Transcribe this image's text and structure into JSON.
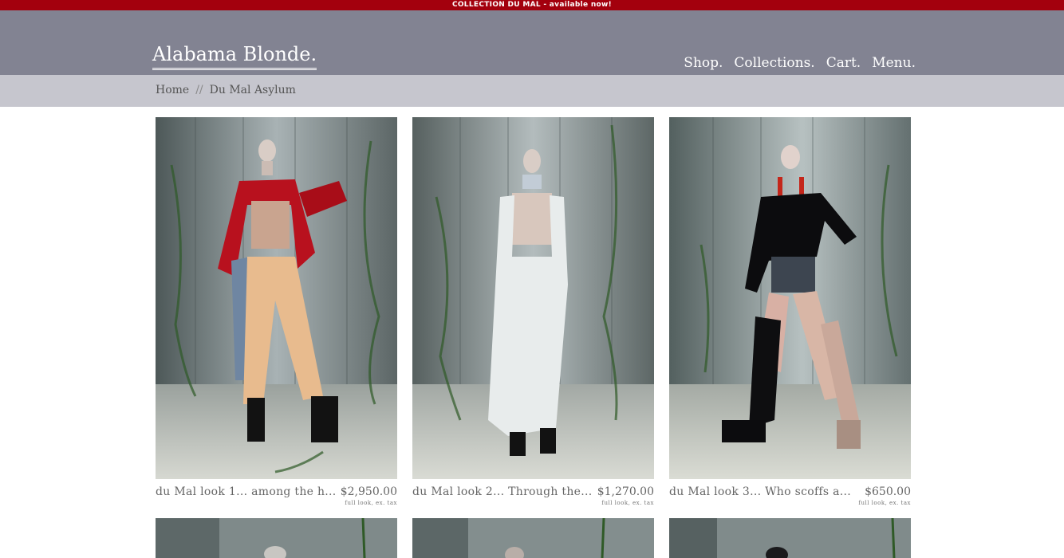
{
  "announcement": "COLLECTION DU MAL - available now!",
  "brand": "Alabama Blonde.",
  "nav": [
    "Shop.",
    "Collections.",
    "Cart.",
    "Menu."
  ],
  "breadcrumb": {
    "home": "Home",
    "separator": "//",
    "current": "Du Mal Asylum"
  },
  "products": [
    {
      "title": "du Mal look 1... among the h...",
      "price": "$2,950.00",
      "note": "full look, ex. tax"
    },
    {
      "title": "du Mal look 2... Through the...",
      "price": "$1,270.00",
      "note": "full look, ex. tax"
    },
    {
      "title": "du Mal look 3... Who scoffs a...",
      "price": "$650.00",
      "note": "full look, ex. tax"
    }
  ],
  "colors": {
    "announce_bar": "#a3000d",
    "header": "#828392",
    "breadcrumb_bar": "#c6c6ce"
  }
}
